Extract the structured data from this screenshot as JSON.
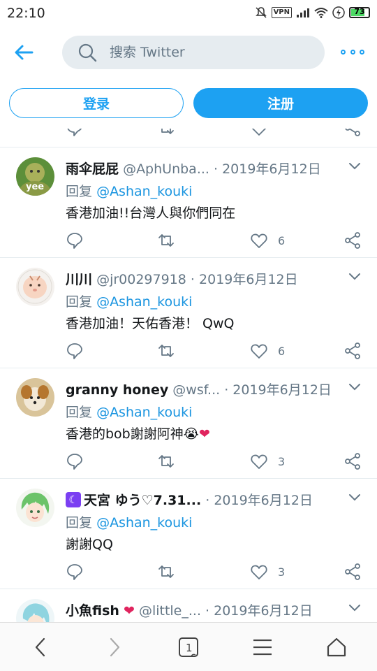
{
  "status_bar": {
    "time": "22:10",
    "vpn_label": "VPN",
    "battery_level": "73"
  },
  "header": {
    "search_placeholder": "搜索 Twitter"
  },
  "auth": {
    "login_label": "登录",
    "signup_label": "注册"
  },
  "tweets": [
    {
      "name": "雨伞屁屁",
      "handle": "@AphUnba...",
      "date": "2019年6月12日",
      "reply_prefix": "回复",
      "reply_to": "@Ashan_kouki",
      "text": "香港加油!!台灣人與你們同在",
      "likes": "6",
      "avatar_label": "yee"
    },
    {
      "name": "川川",
      "handle": "@jr00297918",
      "date": "2019年6月12日",
      "reply_prefix": "回复",
      "reply_to": "@Ashan_kouki",
      "text": "香港加油！天佑香港！ QwQ",
      "likes": "6"
    },
    {
      "name": "granny honey",
      "handle": "@wsf...",
      "date": "2019年6月12日",
      "reply_prefix": "回复",
      "reply_to": "@Ashan_kouki",
      "text": "香港的bob謝謝阿神😭",
      "text_heart": "❤",
      "likes": "3"
    },
    {
      "name_badge": "☾",
      "name": "天宮 ゆう♡7.31...",
      "handle": "",
      "date": "2019年6月12日",
      "reply_prefix": "回复",
      "reply_to": "@Ashan_kouki",
      "text": "謝謝QQ",
      "likes": "3"
    },
    {
      "name": "小魚fish",
      "name_heart": "❤",
      "handle": "@little_...",
      "date": "2019年6月12日"
    }
  ],
  "bottom_nav": {
    "tab_count": "1"
  },
  "colors": {
    "accent": "#1da1f2",
    "muted_text": "#657786",
    "divider": "#e6ecf0",
    "heart": "#e0245e"
  },
  "icons": [
    "back-arrow-icon",
    "search-icon",
    "more-dots-icon",
    "reply-icon",
    "retweet-icon",
    "like-icon",
    "share-icon",
    "chevron-down-icon",
    "nav-back-icon",
    "nav-forward-icon",
    "tabs-icon",
    "menu-icon",
    "home-icon"
  ]
}
